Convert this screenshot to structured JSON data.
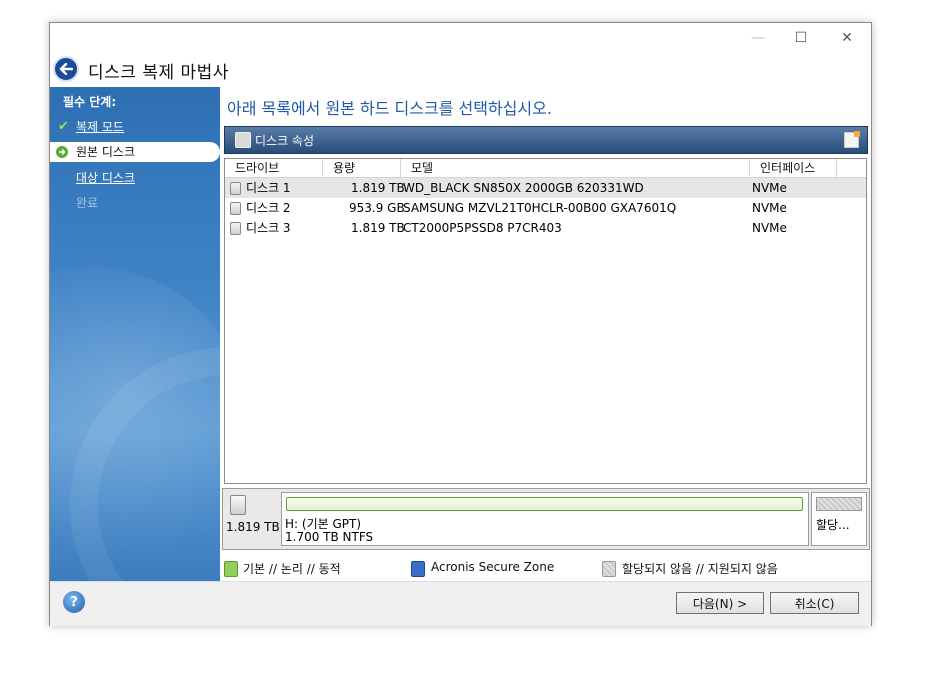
{
  "window": {
    "title": "디스크 복제 마법사",
    "controls": {
      "minimize": "—",
      "maximize": "☐",
      "close": "✕"
    }
  },
  "sidebar": {
    "heading": "필수 단계:",
    "items": [
      {
        "label": "복제 모드",
        "state": "done",
        "icon": "check-icon"
      },
      {
        "label": "원본 디스크",
        "state": "current",
        "icon": "arrow-right-icon"
      },
      {
        "label": "대상 디스크",
        "state": "link"
      },
      {
        "label": "완료",
        "state": "disabled"
      }
    ]
  },
  "main": {
    "heading": "아래 목록에서 원본 하드 디스크를 선택하십시오.",
    "toolbar": {
      "label": "디스크 속성"
    },
    "table": {
      "columns": [
        "드라이브",
        "용량",
        "모델",
        "인터페이스"
      ],
      "rows": [
        {
          "drive": "디스크 1",
          "capacity": "1.819 TB",
          "model": "WD_BLACK SN850X 2000GB 620331WD",
          "interface": "NVMe",
          "selected": true
        },
        {
          "drive": "디스크 2",
          "capacity": "953.9 GB",
          "model": "SAMSUNG MZVL21T0HCLR-00B00 GXA7601Q",
          "interface": "NVMe",
          "selected": false
        },
        {
          "drive": "디스크 3",
          "capacity": "1.819 TB",
          "model": "CT2000P5PSSD8 P7CR403",
          "interface": "NVMe",
          "selected": false
        }
      ]
    },
    "diskmap": {
      "disk_size": "1.819 TB",
      "partition_label": "H: (기본 GPT)",
      "partition_size": "1.700 TB  NTFS",
      "unallocated_label": "할당..."
    },
    "legend": [
      {
        "label": "기본 // 논리 // 동적",
        "color": "#8fcf5a"
      },
      {
        "label": "Acronis Secure Zone",
        "color": "#3a6fc9"
      },
      {
        "label": "할당되지 않음 // 지원되지 않음",
        "color": "#c8c8c8"
      }
    ]
  },
  "footer": {
    "next_label": "다음(N) >",
    "cancel_label": "취소(C)",
    "help_label": "?"
  }
}
